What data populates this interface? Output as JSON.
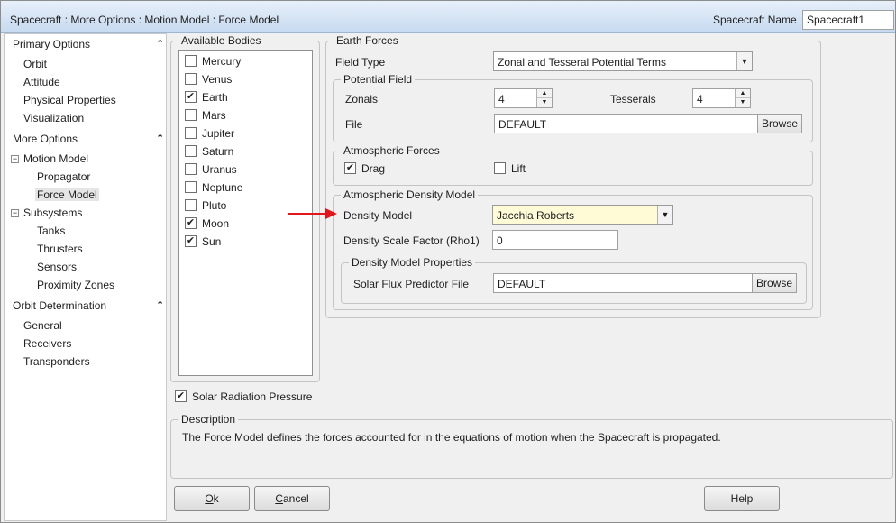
{
  "window": {
    "title": "Spacecraft : More Options : Motion Model : Force Model",
    "spacecraft_name_label": "Spacecraft Name",
    "spacecraft_name_value": "Spacecraft1"
  },
  "nav": {
    "primary_options": "Primary Options",
    "orbit": "Orbit",
    "attitude": "Attitude",
    "physical_properties": "Physical Properties",
    "visualization": "Visualization",
    "more_options": "More Options",
    "motion_model": "Motion Model",
    "propagator": "Propagator",
    "force_model": "Force Model",
    "subsystems": "Subsystems",
    "tanks": "Tanks",
    "thrusters": "Thrusters",
    "sensors": "Sensors",
    "proximity_zones": "Proximity Zones",
    "orbit_determination": "Orbit Determination",
    "general": "General",
    "receivers": "Receivers",
    "transponders": "Transponders",
    "collapse_glyph": "⌃",
    "tree_box_glyph": "−"
  },
  "bodies": {
    "title": "Available Bodies",
    "items": [
      {
        "label": "Mercury",
        "checked": ""
      },
      {
        "label": "Venus",
        "checked": ""
      },
      {
        "label": "Earth",
        "checked": "✔"
      },
      {
        "label": "Mars",
        "checked": ""
      },
      {
        "label": "Jupiter",
        "checked": ""
      },
      {
        "label": "Saturn",
        "checked": ""
      },
      {
        "label": "Uranus",
        "checked": ""
      },
      {
        "label": "Neptune",
        "checked": ""
      },
      {
        "label": "Pluto",
        "checked": ""
      },
      {
        "label": "Moon",
        "checked": "✔"
      },
      {
        "label": "Sun",
        "checked": "✔"
      }
    ]
  },
  "srp": {
    "label": "Solar Radiation Pressure",
    "checked": "✔"
  },
  "earth_forces": {
    "title": "Earth Forces",
    "field_type_label": "Field Type",
    "field_type_value": "Zonal and Tesseral Potential Terms",
    "potential_field": {
      "title": "Potential Field",
      "zonals_label": "Zonals",
      "zonals_value": "4",
      "tesserals_label": "Tesserals",
      "tesserals_value": "4",
      "file_label": "File",
      "file_value": "DEFAULT",
      "browse": "Browse"
    },
    "atmospheric_forces": {
      "title": "Atmospheric Forces",
      "drag_label": "Drag",
      "drag_checked": "✔",
      "lift_label": "Lift",
      "lift_checked": ""
    },
    "density": {
      "title": "Atmospheric Density Model",
      "model_label": "Density Model",
      "model_value": "Jacchia Roberts",
      "scale_label": "Density Scale Factor (Rho1)",
      "scale_value": "0",
      "properties": {
        "title": "Density Model Properties",
        "flux_label": "Solar Flux Predictor File",
        "flux_value": "DEFAULT",
        "browse": "Browse"
      }
    }
  },
  "description": {
    "title": "Description",
    "text": "The Force Model defines the forces accounted for in the equations of motion when the Spacecraft is propagated."
  },
  "buttons": {
    "ok_u": "O",
    "ok_rest": "k",
    "cancel_u": "C",
    "cancel_rest": "ancel",
    "help": "Help"
  },
  "icons": {
    "spin_up": "▲",
    "spin_down": "▼",
    "combo_arrow": "▼"
  },
  "colors": {
    "arrow": "#e3141b",
    "highlight_field": "#fffbd6",
    "title_bar": "#c7daf0"
  }
}
